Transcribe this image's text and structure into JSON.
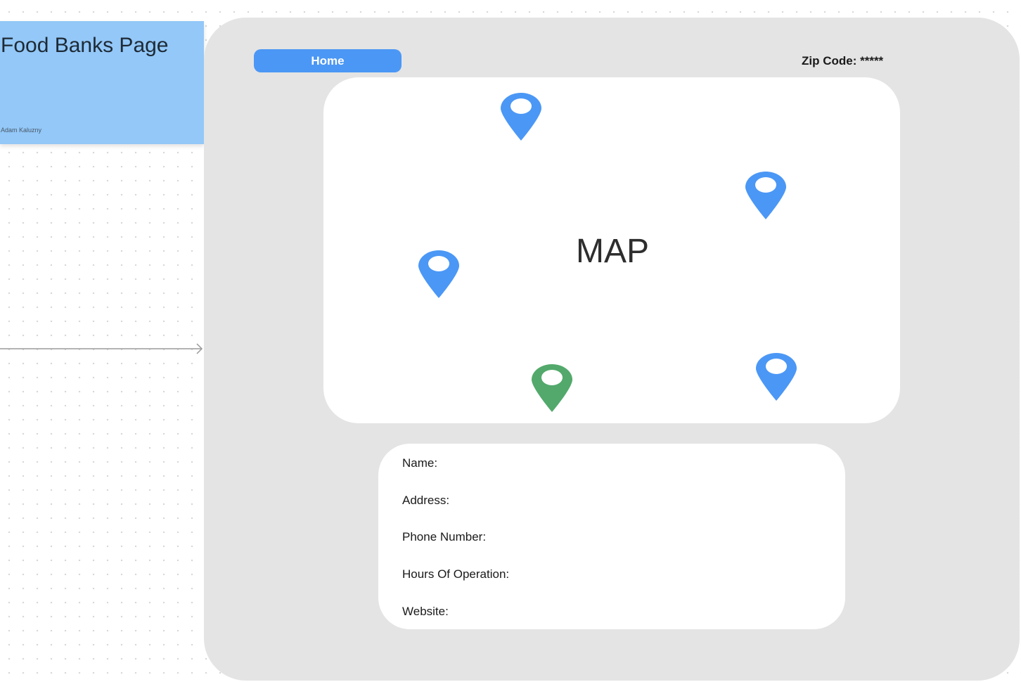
{
  "sticky_note": {
    "title": "Food Banks Page",
    "author": "Adam Kaluzny",
    "color": "#93c8f8"
  },
  "header": {
    "home_label": "Home",
    "zip_code_label": "Zip Code: *****"
  },
  "map": {
    "label": "MAP",
    "pins": [
      {
        "icon": "map-pin-icon",
        "color": "#4b97f5"
      },
      {
        "icon": "map-pin-icon",
        "color": "#4b97f5"
      },
      {
        "icon": "map-pin-icon",
        "color": "#4b97f5"
      },
      {
        "icon": "map-pin-icon",
        "color": "#52a96b"
      },
      {
        "icon": "map-pin-icon",
        "color": "#4b97f5"
      }
    ]
  },
  "details": {
    "name_label": "Name:",
    "address_label": "Address:",
    "phone_label": "Phone Number:",
    "hours_label": "Hours Of Operation:",
    "website_label": "Website:"
  },
  "colors": {
    "accent": "#4b97f5",
    "selected_pin": "#52a96b",
    "frame": "#e4e4e4"
  }
}
